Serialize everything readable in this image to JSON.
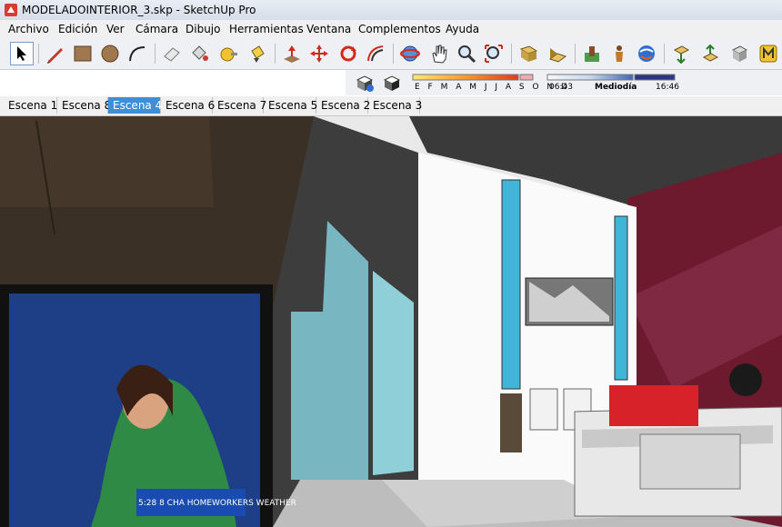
{
  "window": {
    "title": "MODELADOINTERIOR_3.skp - SketchUp Pro"
  },
  "menu": [
    "Archivo",
    "Edición",
    "Ver",
    "Cámara",
    "Dibujo",
    "Herramientas",
    "Ventana",
    "Complementos",
    "Ayuda"
  ],
  "toolbar": {
    "tools": [
      "select-tool",
      "line-tool",
      "rectangle-tool",
      "circle-tool",
      "arc-tool",
      "eraser-tool",
      "paint-bucket-tool",
      "tape-measure-tool",
      "push-pull-tool",
      "move-tool",
      "rotate-tool",
      "offset-tool",
      "orbit-tool",
      "pan-tool",
      "zoom-tool",
      "zoom-extents-tool",
      "previous-view-tool",
      "next-view-tool",
      "add-location-tool",
      "get-models-tool",
      "share-model-tool",
      "google-earth-tool",
      "get-photo-texture-tool",
      "share-component-tool",
      "extension-warehouse-tool"
    ]
  },
  "shadows": {
    "months": "E F M A M J J A S O N D",
    "time_start": "06:43",
    "time_mid": "Mediodía",
    "time_end": "16:46"
  },
  "scenes": {
    "tabs": [
      "Escena 1",
      "Escena 8",
      "Escena 4",
      "Escena 6",
      "Escena 7",
      "Escena 5",
      "Escena 2",
      "Escena 3"
    ],
    "active": "Escena 4"
  },
  "viewport": {
    "tv_overlay": "5:28 8 CHA  HOMEWORKERS WEATHER"
  },
  "colors": {
    "accent": "#3f8fd8",
    "wall_red": "#6e1a2e",
    "cushion": "#d8222a"
  }
}
